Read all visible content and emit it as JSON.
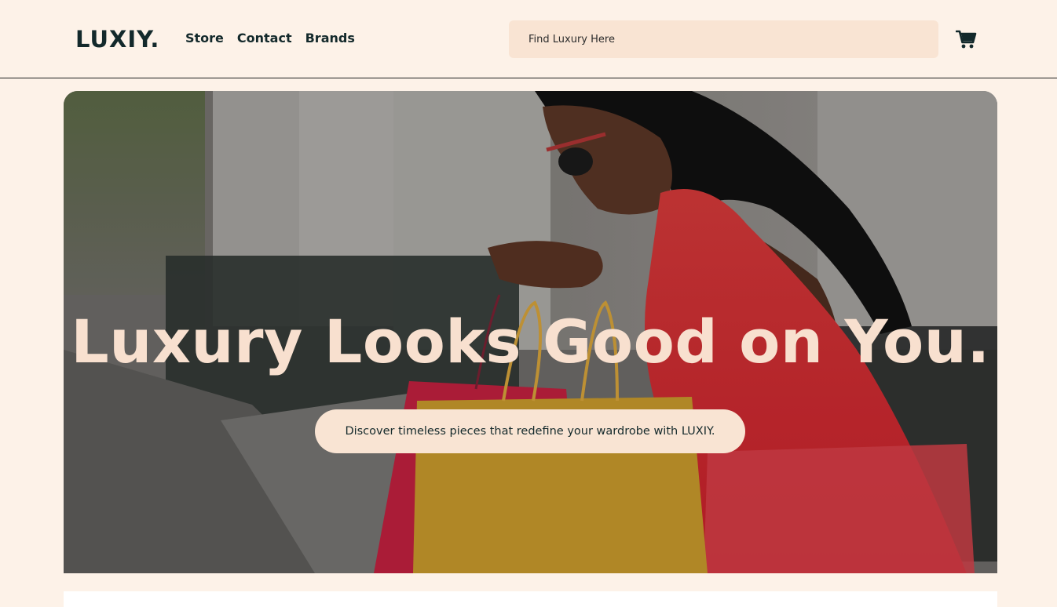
{
  "header": {
    "logo": "LUXIY.",
    "nav": [
      {
        "label": "Store"
      },
      {
        "label": "Contact"
      },
      {
        "label": "Brands"
      }
    ],
    "search": {
      "placeholder": "Find Luxury Here",
      "value": ""
    },
    "cart_icon": "shopping-cart-icon"
  },
  "hero": {
    "title": "Luxury Looks Good on You.",
    "tagline": "Discover timeless pieces that redefine your wardrobe with LUXIY."
  },
  "colors": {
    "background": "#fdf2e8",
    "accent": "#f9e4d3",
    "text_dark": "#13292b",
    "hero_title": "#f8e0cf"
  }
}
